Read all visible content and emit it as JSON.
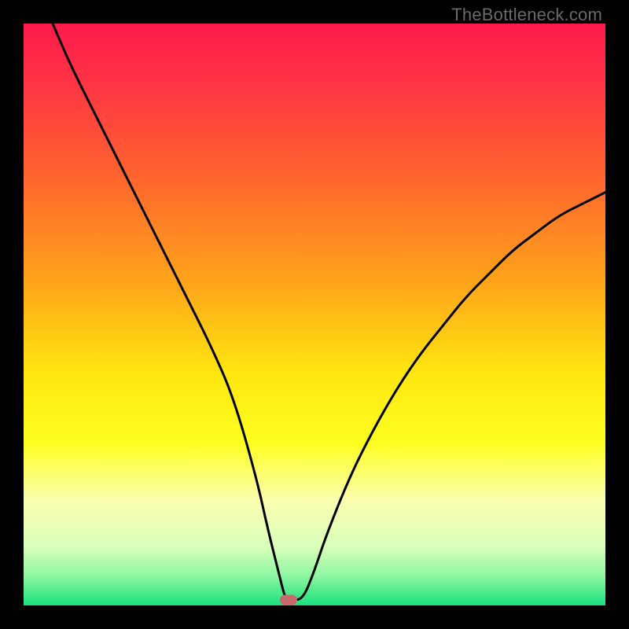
{
  "watermark": "TheBottleneck.com",
  "chart_data": {
    "type": "line",
    "title": "",
    "xlabel": "",
    "ylabel": "",
    "xlim": [
      0,
      100
    ],
    "ylim": [
      0,
      100
    ],
    "grid": false,
    "series": [
      {
        "name": "bottleneck-curve",
        "x": [
          5,
          8,
          12,
          16,
          20,
          24,
          28,
          32,
          36,
          40,
          42,
          44,
          45,
          46,
          48,
          50,
          52,
          56,
          60,
          64,
          68,
          72,
          76,
          80,
          84,
          88,
          92,
          96,
          100
        ],
        "y": [
          100,
          93,
          85,
          77,
          69,
          61,
          53,
          45,
          36,
          22,
          13,
          5,
          1,
          1,
          1,
          6,
          12,
          22,
          30,
          37,
          43,
          48,
          53,
          57,
          61,
          64,
          67,
          69,
          71
        ]
      }
    ],
    "marker": {
      "x": 45.5,
      "y": 1,
      "color": "#c9686a"
    },
    "background_gradient": {
      "stops": [
        {
          "p": 0,
          "c": "#ff1a4b"
        },
        {
          "p": 10,
          "c": "#ff3345"
        },
        {
          "p": 25,
          "c": "#ff602f"
        },
        {
          "p": 45,
          "c": "#ffa619"
        },
        {
          "p": 60,
          "c": "#ffe60f"
        },
        {
          "p": 72,
          "c": "#fdff1f"
        },
        {
          "p": 82,
          "c": "#fbffb0"
        },
        {
          "p": 90,
          "c": "#d8ffba"
        },
        {
          "p": 95,
          "c": "#8bf7a0"
        },
        {
          "p": 100,
          "c": "#19e07e"
        }
      ]
    }
  }
}
